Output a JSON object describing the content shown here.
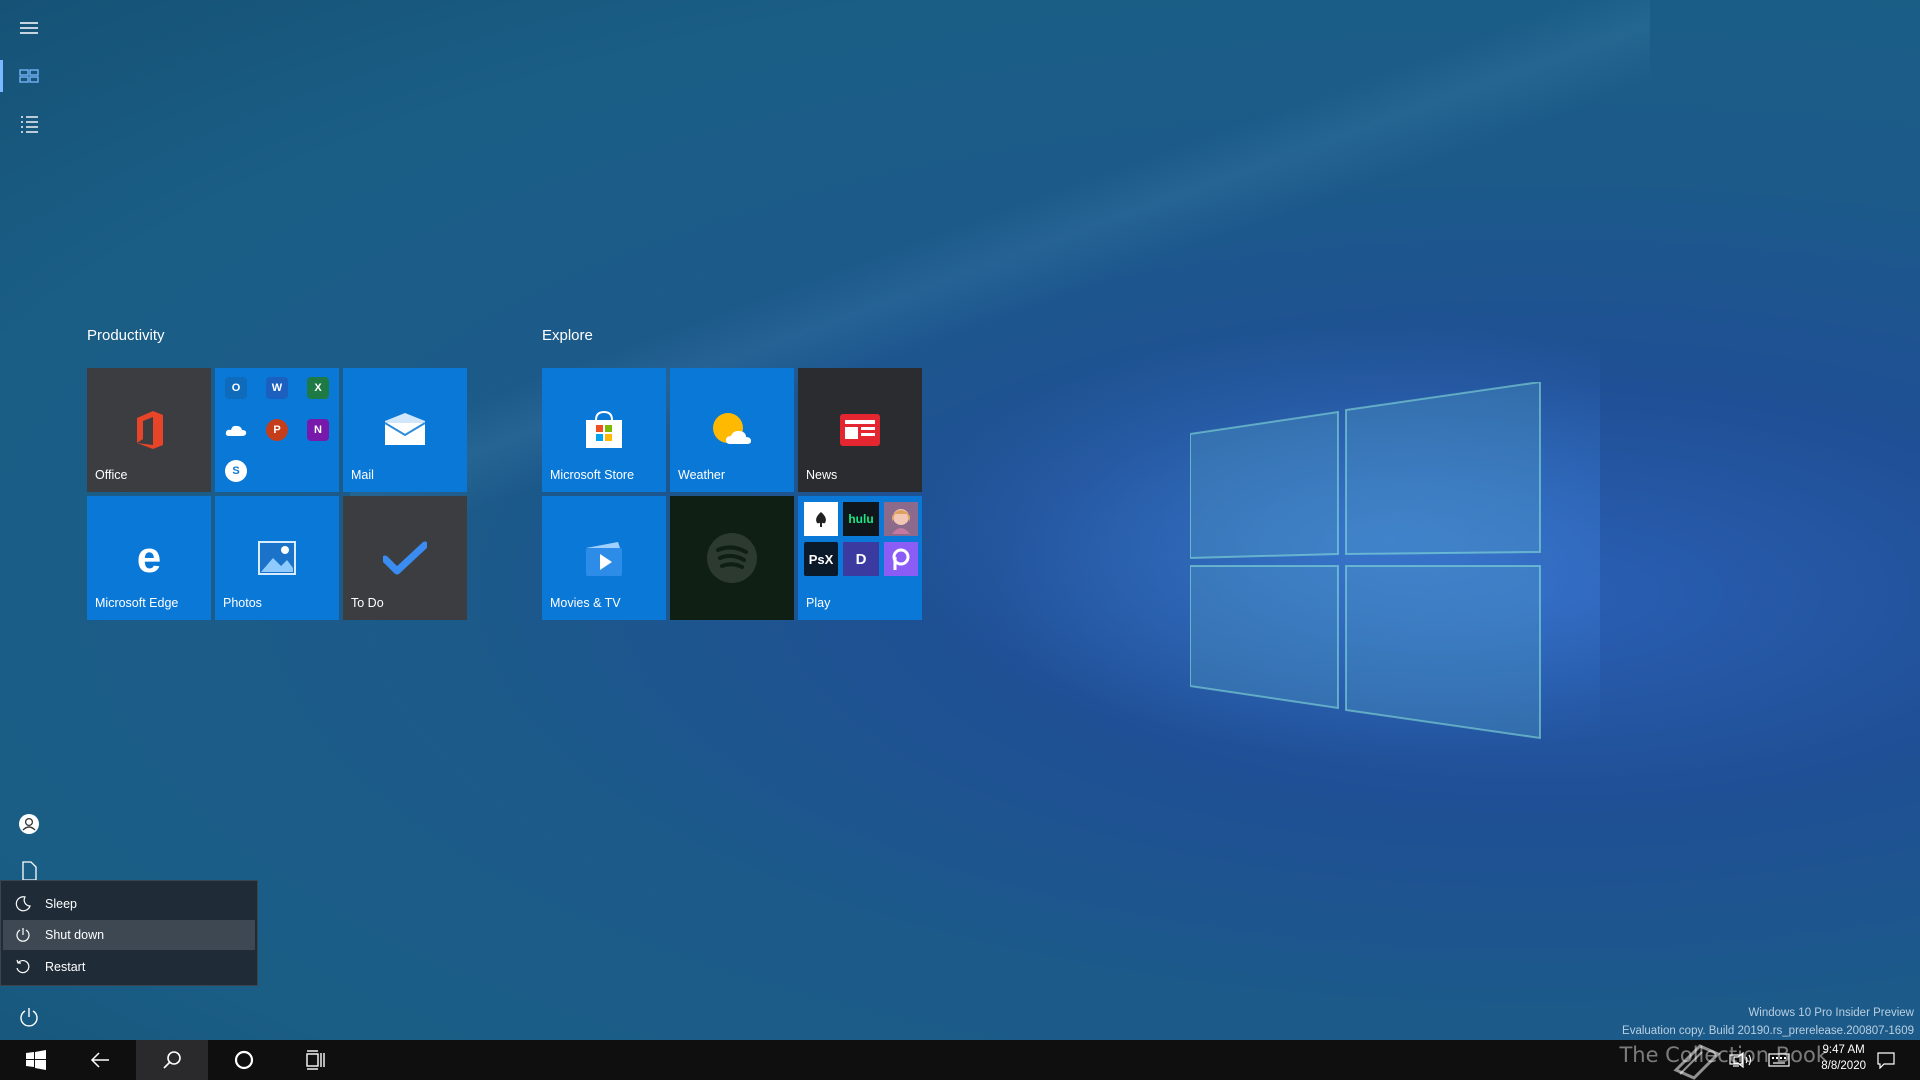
{
  "start": {
    "groups": [
      {
        "title": "Productivity",
        "tiles": [
          {
            "label": "Office"
          },
          {
            "label": ""
          },
          {
            "label": "Mail"
          },
          {
            "label": "Microsoft Edge"
          },
          {
            "label": "Photos"
          },
          {
            "label": "To Do"
          }
        ]
      },
      {
        "title": "Explore",
        "tiles": [
          {
            "label": "Microsoft Store"
          },
          {
            "label": "Weather"
          },
          {
            "label": "News"
          },
          {
            "label": "Movies & TV"
          },
          {
            "label": ""
          },
          {
            "label": "Play"
          }
        ]
      }
    ],
    "mini_apps": {
      "hulu": "hulu",
      "psx": "PsX",
      "dolby": "D"
    },
    "power_menu": {
      "items": [
        {
          "label": "Sleep"
        },
        {
          "label": "Shut down"
        },
        {
          "label": "Restart"
        }
      ],
      "selected": "Shut down"
    }
  },
  "watermark": {
    "line1": "Windows 10 Pro Insider Preview",
    "line2": "Evaluation copy. Build 20190.rs_prerelease.200807-1609"
  },
  "taskbar": {
    "clock_time": "9:47 AM",
    "clock_date": "8/8/2020",
    "brand": "The Collection Book"
  },
  "colors": {
    "tile_blue": "#0a78d7",
    "tile_grey": "#3b3d40",
    "accent": "#7ab8ff"
  }
}
